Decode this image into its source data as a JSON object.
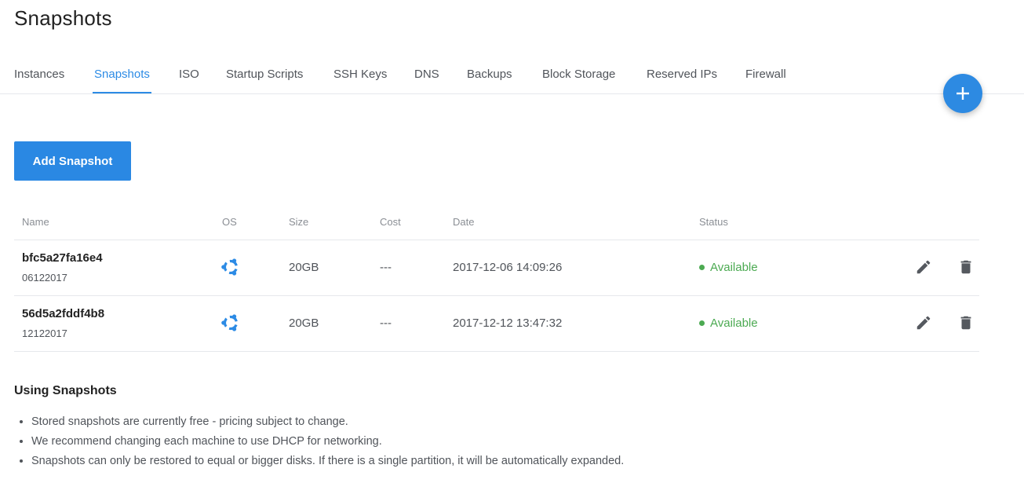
{
  "page": {
    "title": "Snapshots"
  },
  "tabs": [
    {
      "label": "Instances",
      "active": false
    },
    {
      "label": "Snapshots",
      "active": true
    },
    {
      "label": "ISO",
      "active": false
    },
    {
      "label": "Startup Scripts",
      "active": false
    },
    {
      "label": "SSH Keys",
      "active": false
    },
    {
      "label": "DNS",
      "active": false
    },
    {
      "label": "Backups",
      "active": false
    },
    {
      "label": "Block Storage",
      "active": false
    },
    {
      "label": "Reserved IPs",
      "active": false
    },
    {
      "label": "Firewall",
      "active": false
    }
  ],
  "fab": {
    "icon": "plus-icon"
  },
  "add_button": {
    "label": "Add Snapshot"
  },
  "table": {
    "columns": [
      "Name",
      "OS",
      "Size",
      "Cost",
      "Date",
      "Status"
    ],
    "rows": [
      {
        "name": "bfc5a27fa16e4",
        "description": "06122017",
        "os": "ubuntu-icon",
        "size": "20GB",
        "cost": "---",
        "date": "2017-12-06 14:09:26",
        "status": "Available"
      },
      {
        "name": "56d5a2fddf4b8",
        "description": "12122017",
        "os": "ubuntu-icon",
        "size": "20GB",
        "cost": "---",
        "date": "2017-12-12 13:47:32",
        "status": "Available"
      }
    ]
  },
  "info": {
    "title": "Using Snapshots",
    "items": [
      "Stored snapshots are currently free - pricing subject to change.",
      "We recommend changing each machine to use DHCP for networking.",
      "Snapshots can only be restored to equal or bigger disks. If there is a single partition, it will be automatically expanded."
    ]
  },
  "colors": {
    "accent": "#2c8be5",
    "status_available": "#4caa52",
    "button_bg": "#2a88e3"
  }
}
